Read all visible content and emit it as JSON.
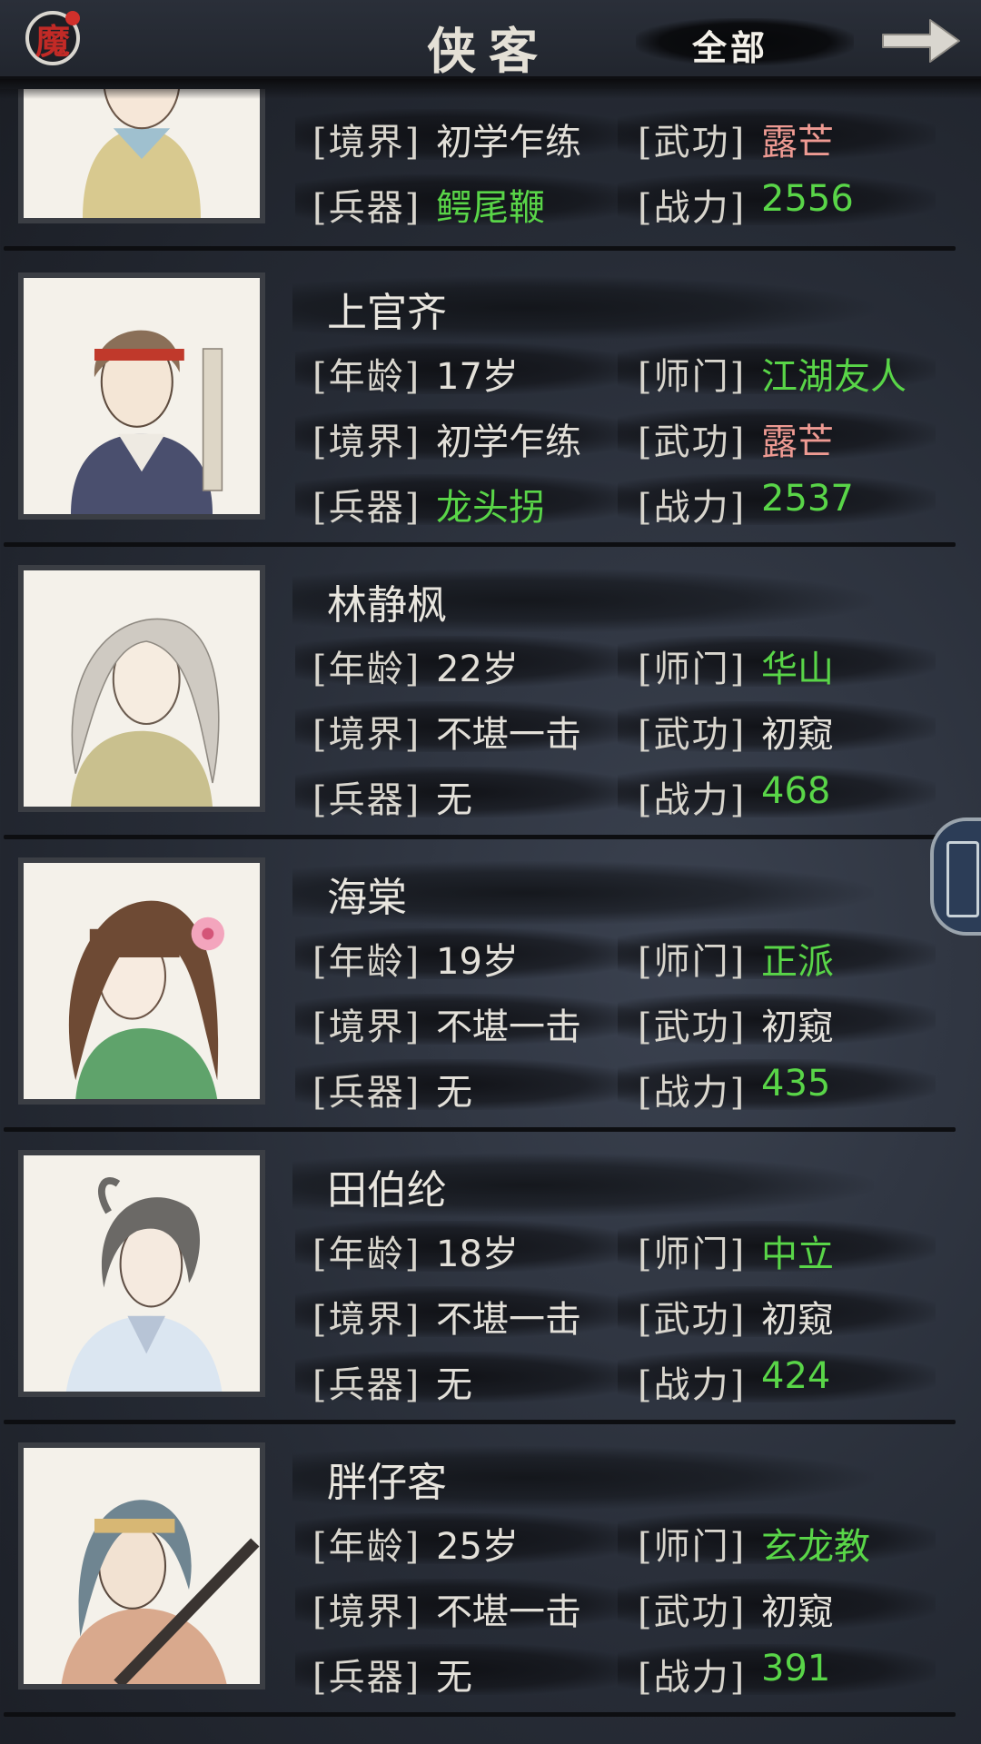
{
  "header": {
    "mo_icon_text": "魔",
    "title": "侠客",
    "filter": "全部",
    "next_icon": "arrow-right-icon"
  },
  "labels": {
    "age": "[年龄]",
    "realm": "[境界]",
    "weapon": "[兵器]",
    "sect": "[师门]",
    "skill": "[武功]",
    "power": "[战力]"
  },
  "colors": {
    "green_value": "#59d548",
    "pink_value": "#ee9a92",
    "text": "#e3e0d9",
    "background": "#262b35"
  },
  "characters": [
    {
      "name": "",
      "age": "",
      "sect": "",
      "realm": "初学乍练",
      "skill": "露芒",
      "weapon": "鳄尾鞭",
      "power": "2556"
    },
    {
      "name": "上官齐",
      "age": "17岁",
      "sect": "江湖友人",
      "realm": "初学乍练",
      "skill": "露芒",
      "weapon": "龙头拐",
      "power": "2537"
    },
    {
      "name": "林静枫",
      "age": "22岁",
      "sect": "华山",
      "realm": "不堪一击",
      "skill": "初窥",
      "weapon": "无",
      "power": "468"
    },
    {
      "name": "海棠",
      "age": "19岁",
      "sect": "正派",
      "realm": "不堪一击",
      "skill": "初窥",
      "weapon": "无",
      "power": "435"
    },
    {
      "name": "田伯纶",
      "age": "18岁",
      "sect": "中立",
      "realm": "不堪一击",
      "skill": "初窥",
      "weapon": "无",
      "power": "424"
    },
    {
      "name": "胖仔客",
      "age": "25岁",
      "sect": "玄龙教",
      "realm": "不堪一击",
      "skill": "初窥",
      "weapon": "无",
      "power": "391"
    }
  ]
}
